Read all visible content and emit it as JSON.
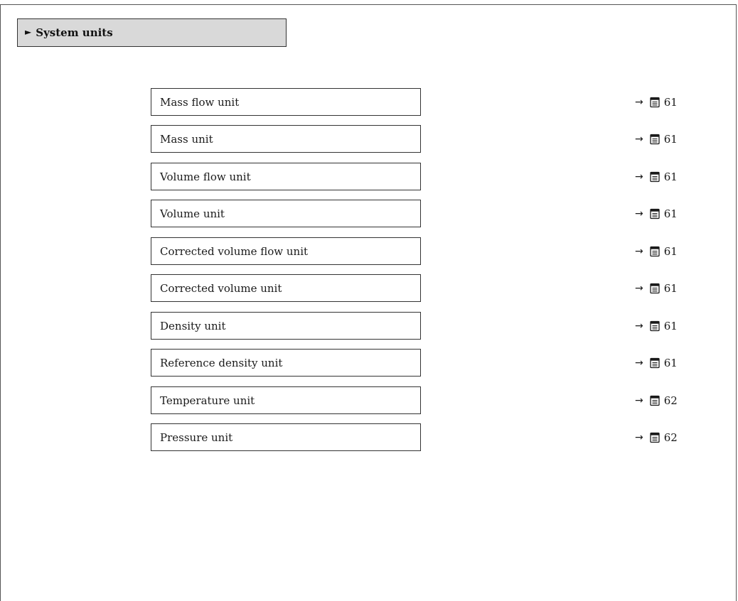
{
  "header": {
    "marker": "►",
    "title": "System units"
  },
  "parameters": [
    {
      "label": "Mass flow unit",
      "arrow": "→",
      "page": "61"
    },
    {
      "label": "Mass unit",
      "arrow": "→",
      "page": "61"
    },
    {
      "label": "Volume flow unit",
      "arrow": "→",
      "page": "61"
    },
    {
      "label": "Volume unit",
      "arrow": "→",
      "page": "61"
    },
    {
      "label": "Corrected volume flow unit",
      "arrow": "→",
      "page": "61"
    },
    {
      "label": "Corrected volume unit",
      "arrow": "→",
      "page": "61"
    },
    {
      "label": "Density unit",
      "arrow": "→",
      "page": "61"
    },
    {
      "label": "Reference density unit",
      "arrow": "→",
      "page": "61"
    },
    {
      "label": "Temperature unit",
      "arrow": "→",
      "page": "62"
    },
    {
      "label": "Pressure unit",
      "arrow": "→",
      "page": "62"
    }
  ],
  "icons": {
    "page_reference": "book-page-icon"
  }
}
